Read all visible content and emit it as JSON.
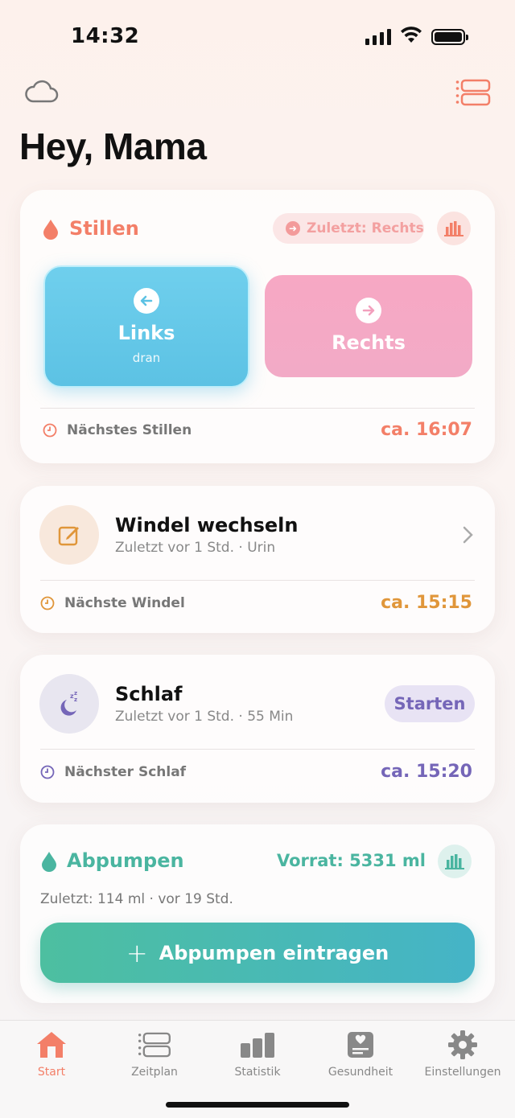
{
  "status_bar": {
    "time": "14:32"
  },
  "greeting": "Hey, Mama",
  "stillen": {
    "title": "Stillen",
    "last_pill": "Zuletzt: Rechts",
    "left": {
      "label": "Links",
      "sub": "dran"
    },
    "right": {
      "label": "Rechts"
    },
    "next_label": "Nächstes Stillen",
    "next_value": "ca. 16:07"
  },
  "windel": {
    "title": "Windel wechseln",
    "subtitle": "Zuletzt vor 1 Std. · Urin",
    "next_label": "Nächste Windel",
    "next_value": "ca. 15:15"
  },
  "schlaf": {
    "title": "Schlaf",
    "subtitle": "Zuletzt vor 1 Std. · 55 Min",
    "button": "Starten",
    "next_label": "Nächster Schlaf",
    "next_value": "ca. 15:20"
  },
  "abpumpen": {
    "title": "Abpumpen",
    "stock": "Vorrat: 5331 ml",
    "last": "Zuletzt: 114 ml · vor 19 Std.",
    "button": "Abpumpen eintragen"
  },
  "tabs": [
    {
      "label": "Start",
      "icon": "home-icon",
      "active": true
    },
    {
      "label": "Zeitplan",
      "icon": "schedule-icon"
    },
    {
      "label": "Statistik",
      "icon": "chart-icon"
    },
    {
      "label": "Gesundheit",
      "icon": "health-icon"
    },
    {
      "label": "Einstellungen",
      "icon": "gear-icon"
    }
  ],
  "colors": {
    "accent": "#f37f68",
    "blue": "#5cc2e4",
    "pink": "#f2aac6",
    "orange": "#e0963a",
    "purple": "#7566b8",
    "teal": "#4ab5a0"
  }
}
